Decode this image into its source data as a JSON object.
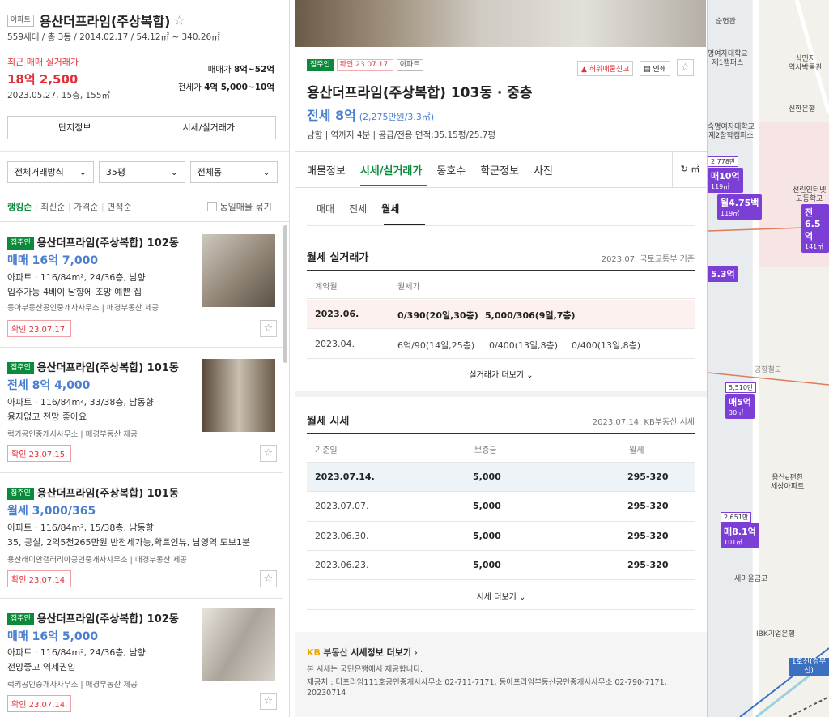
{
  "complex": {
    "type_tag": "아파트",
    "name": "용산더프라임(주상복합)",
    "summary": "559세대 / 총 3동 / 2014.02.17 / 54.12㎡ ~ 340.26㎡",
    "recent_label": "최근 매매 실거래가",
    "recent_price": "18억 2,500",
    "recent_detail": "2023.05.27, 15층, 155㎡",
    "sale_range_label": "매매가",
    "sale_range": "8억~52억",
    "jeonse_range_label": "전세가",
    "jeonse_range": "4억 5,000~10억",
    "btn_info": "단지정보",
    "btn_price": "시세/실거래가"
  },
  "filters": {
    "deal": "전체거래방식",
    "area": "35평",
    "dong": "전체동"
  },
  "sort": {
    "items": [
      "랭킹순",
      "최신순",
      "가격순",
      "면적순"
    ],
    "same_label": "동일매물 묶기"
  },
  "listings": [
    {
      "tag": "집주인",
      "title": "용산더프라임(주상복합) 102동",
      "price": "매매 16억 7,000",
      "line1": "아파트 · 116/84m², 24/36층, 남향",
      "line2": "입주가능 4베이 남향에 조망 예쁜 집",
      "source": "동아부동산공인중개사사무소",
      "provider": "매경부동산 제공",
      "check": "확인 23.07.17."
    },
    {
      "tag": "집주인",
      "title": "용산더프라임(주상복합) 101동",
      "price": "전세 8억 4,000",
      "line1": "아파트 · 116/84m², 33/38층, 남동향",
      "line2": "융자없고 전망 좋아요",
      "source": "럭키공인중개사사무소",
      "provider": "매경부동산 제공",
      "check": "확인 23.07.15."
    },
    {
      "tag": "집주인",
      "title": "용산더프라임(주상복합) 101동",
      "price": "월세 3,000/365",
      "line1": "아파트 · 116/84m², 15/38층, 남동향",
      "line2": "35, 공실, 2억5천265만원 반전세가능,확트인뷰, 남영역 도보1분",
      "source": "용산래미안갤러리아공인중개사사무소",
      "provider": "매경부동산 제공",
      "check": "확인 23.07.14."
    },
    {
      "tag": "집주인",
      "title": "용산더프라임(주상복합) 102동",
      "price": "매매 16억 5,000",
      "line1": "아파트 · 116/84m², 24/36층, 남향",
      "line2": "전망좋고 역세권임",
      "source": "럭키공인중개사사무소",
      "provider": "매경부동산 제공",
      "check": "확인 23.07.14."
    }
  ],
  "detail": {
    "tag_owner": "집주인",
    "tag_check": "확인 23.07.17.",
    "tag_type": "아파트",
    "report_btn": "허위매물신고",
    "print_btn": "인쇄",
    "title": "용산더프라임(주상복합) 103동 · 중층",
    "price": "전세 8억",
    "price_sub": "(2,275만원/3.3㎡)",
    "info": "남향 | 역까지 4분 | 공급/전용 면적:35.15평/25.7평",
    "tabs": [
      "매물정보",
      "시세/실거래가",
      "동호수",
      "학군정보",
      "사진"
    ],
    "unit_btn": "㎡",
    "subtabs": [
      "매매",
      "전세",
      "월세"
    ],
    "real_title": "월세 실거래가",
    "real_source": "2023.07. 국토교통부 기준",
    "real_head": [
      "계약월",
      "월세가"
    ],
    "real_rows": [
      {
        "month": "2023.06.",
        "v1": "0/390(20일,30층)",
        "v2": "5,000/306(9일,7층)",
        "v3": ""
      },
      {
        "month": "2023.04.",
        "v1": "6억/90(14일,25층)",
        "v2": "0/400(13일,8층)",
        "v3": "0/400(13일,8층)"
      }
    ],
    "real_more": "실거래가 더보기",
    "quote_title": "월세 시세",
    "quote_source": "2023.07.14. KB부동산 시세",
    "quote_head": [
      "기준일",
      "보증금",
      "월세"
    ],
    "quote_rows": [
      {
        "date": "2023.07.14.",
        "deposit": "5,000",
        "rent": "295-320"
      },
      {
        "date": "2023.07.07.",
        "deposit": "5,000",
        "rent": "295-320"
      },
      {
        "date": "2023.06.30.",
        "deposit": "5,000",
        "rent": "295-320"
      },
      {
        "date": "2023.06.23.",
        "deposit": "5,000",
        "rent": "295-320"
      }
    ],
    "quote_more": "시세 더보기",
    "kb_logo": "KB",
    "kb_brand": "부동산",
    "kb_link": "시세정보 더보기",
    "footer1": "본 시세는 국민은행에서 제공합니다.",
    "footer2": "제공처 : 더프라임111호공인중개사사무소 02-711-7171, 동아프라임부동산공인중개사사무소 02-790-7171,",
    "footer3": "20230714"
  },
  "map": {
    "labels": [
      "순헌관",
      "명여자대학교\n제1캠퍼스",
      "식민지\n역사박물관",
      "신한은행",
      "숙명여자대학교\n제2창학캠퍼스",
      "선린인터넷\n고등학교",
      "공항철도",
      "용산e편한\n세상아파트",
      "새마을금고",
      "IBK기업은행",
      "1호선(경부선)"
    ],
    "pins": [
      {
        "top": "2,778만",
        "main": "매10억",
        "sub": "119㎡"
      },
      {
        "top": "",
        "main": "월4.75백",
        "sub": "119㎡"
      },
      {
        "top": "",
        "main": "전6.5억",
        "sub": "141㎡"
      },
      {
        "top": "",
        "main": "5.3억",
        "sub": ""
      },
      {
        "top": "5,510만",
        "main": "매5억",
        "sub": "30㎡"
      },
      {
        "top": "2,651만",
        "main": "매8.1억",
        "sub": "101㎡"
      }
    ]
  }
}
